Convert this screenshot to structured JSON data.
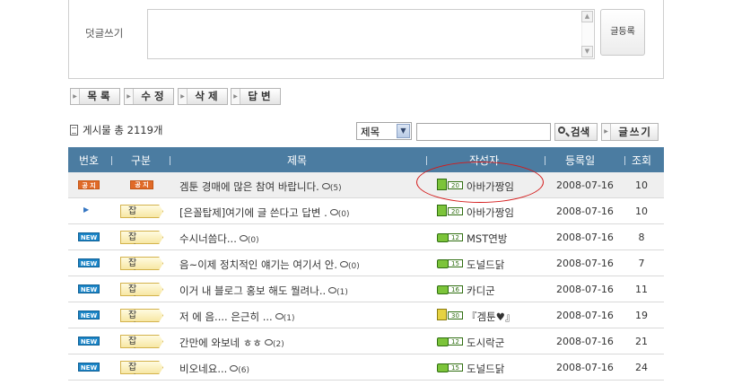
{
  "comment": {
    "label": "덧글쓰기",
    "submit_label": "글등록",
    "textarea_value": ""
  },
  "actions": [
    {
      "label": "목록"
    },
    {
      "label": "수정"
    },
    {
      "label": "삭제"
    },
    {
      "label": "답변"
    }
  ],
  "search": {
    "post_count": "게시물 총 2119개",
    "field_selected": "제목",
    "query": "",
    "search_label": "검색",
    "write_label": "글쓰기"
  },
  "table": {
    "headers": {
      "num": "번호",
      "category": "구분",
      "title": "제목",
      "author": "작성자",
      "date": "등록일",
      "views": "조회"
    },
    "rows": [
      {
        "num_badge": "공 지",
        "num_type": "notice",
        "cat": "공 지",
        "cat_type": "notice",
        "title": "겜툰 경매에 많은 참여 바랍니다.",
        "comments": "(5)",
        "lvl": "20",
        "lvl_face": "green",
        "author": "아바가짱임",
        "date": "2008-07-16",
        "views": "10"
      },
      {
        "num_badge": "",
        "num_type": "arrow",
        "cat": "잡 담",
        "cat_type": "chat",
        "title": "[은꼴탑제]여기에 글 쓴다고 답변 .",
        "comments": "(0)",
        "lvl": "20",
        "lvl_face": "green",
        "author": "아바가짱임",
        "date": "2008-07-16",
        "views": "10"
      },
      {
        "num_badge": "NEW",
        "num_type": "new",
        "cat": "잡 담",
        "cat_type": "chat",
        "title": "수시너씀다...",
        "comments": "(0)",
        "lvl": "12",
        "lvl_face": "wide",
        "author": "MST연방",
        "date": "2008-07-16",
        "views": "8"
      },
      {
        "num_badge": "NEW",
        "num_type": "new",
        "cat": "잡 담",
        "cat_type": "chat",
        "title": "음~이제 정치적인 얘기는 여기서 안.",
        "comments": "(0)",
        "lvl": "15",
        "lvl_face": "wide",
        "author": "도널드닭",
        "date": "2008-07-16",
        "views": "7"
      },
      {
        "num_badge": "NEW",
        "num_type": "new",
        "cat": "잡 담",
        "cat_type": "chat",
        "title": "이거 내 블로그 홍보 해도 뭘려나..",
        "comments": "(1)",
        "lvl": "16",
        "lvl_face": "wide",
        "author": "카디군",
        "date": "2008-07-16",
        "views": "11"
      },
      {
        "num_badge": "NEW",
        "num_type": "new",
        "cat": "잡 담",
        "cat_type": "chat",
        "title": "저 에 음.... 은근히 ...",
        "comments": "(1)",
        "lvl": "30",
        "lvl_face": "yellow",
        "author": "『겜툰♥』",
        "date": "2008-07-16",
        "views": "19"
      },
      {
        "num_badge": "NEW",
        "num_type": "new",
        "cat": "잡 담",
        "cat_type": "chat",
        "title": "간만에 와보네 ㅎㅎ",
        "comments": "(2)",
        "lvl": "12",
        "lvl_face": "wide",
        "author": "도시락군",
        "date": "2008-07-16",
        "views": "21"
      },
      {
        "num_badge": "NEW",
        "num_type": "new",
        "cat": "잡 담",
        "cat_type": "chat",
        "title": "비오네요...",
        "comments": "(6)",
        "lvl": "15",
        "lvl_face": "wide",
        "author": "도널드닭",
        "date": "2008-07-16",
        "views": "24"
      }
    ]
  },
  "colors": {
    "header_bg": "#4b7ca1",
    "notice_badge": "#e06a28",
    "new_badge": "#1c86c8",
    "highlight": "#d41a1a"
  }
}
